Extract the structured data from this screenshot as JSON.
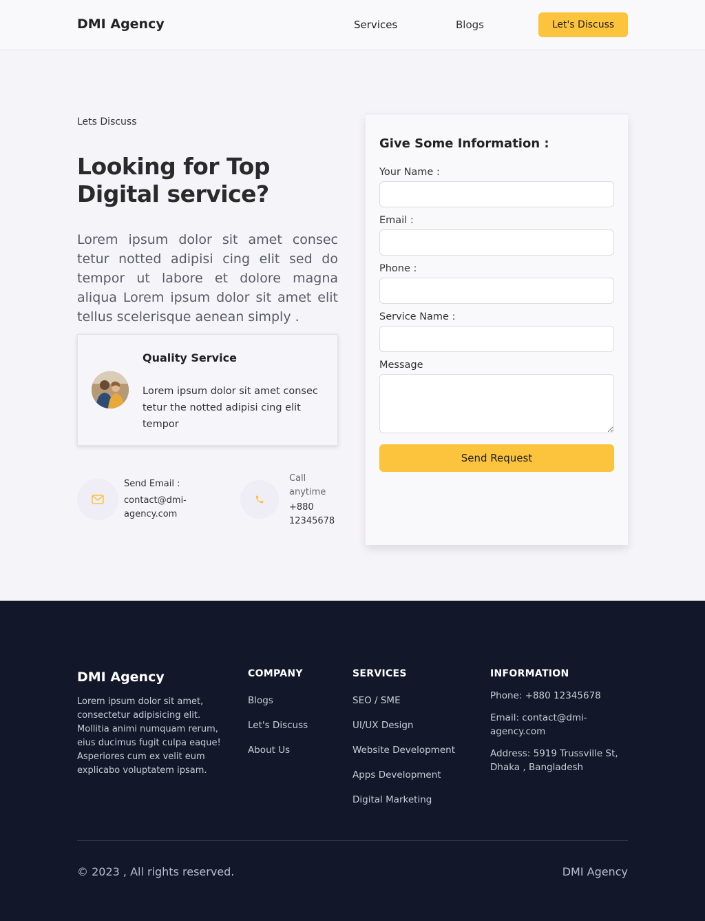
{
  "header": {
    "brand": "DMI Agency",
    "nav": {
      "services": "Services",
      "blogs": "Blogs"
    },
    "cta": "Let's Discuss"
  },
  "hero": {
    "eyebrow": "Lets Discuss",
    "headline": "Looking for Top Digital service?",
    "intro": "Lorem ipsum dolor sit amet consec tetur notted adipisi cing elit sed do tempor ut labore et dolore magna aliqua Lorem ipsum dolor sit amet elit tellus scelerisque aenean simply ."
  },
  "quality": {
    "title": "Quality Service",
    "text": "Lorem ipsum dolor sit amet consec tetur the notted adipisi cing elit tempor"
  },
  "contact": {
    "email_label": "Send Email :",
    "email_value": "contact@dmi-agency.com",
    "call_label": "Call anytime",
    "call_value": "+880 12345678",
    "icons": {
      "email": "mail-icon",
      "call": "phone-icon"
    }
  },
  "form": {
    "title": "Give Some Information :",
    "name_label": "Your Name :",
    "name_value": "",
    "email_label": "Email :",
    "email_value": "",
    "phone_label": "Phone :",
    "phone_value": "",
    "service_label": "Service Name :",
    "service_value": "",
    "message_label": "Message",
    "message_value": "",
    "submit": "Send Request"
  },
  "footer": {
    "brand": "DMI Agency",
    "about": "Lorem ipsum dolor sit amet, consectetur adipisicing elit. Mollitia animi numquam rerum, eius ducimus fugit culpa eaque! Asperiores cum ex velit eum explicabo voluptatem ipsam.",
    "company": {
      "heading": "COMPANY",
      "links": [
        "Blogs",
        "Let's Discuss",
        "About Us"
      ]
    },
    "services": {
      "heading": "SERVICES",
      "links": [
        "SEO / SME",
        "UI/UX Design",
        "Website Development",
        "Apps Development",
        "Digital Marketing"
      ]
    },
    "information": {
      "heading": "INFORMATION",
      "phone": "Phone: +880 12345678",
      "email": "Email: contact@dmi-agency.com",
      "address": "Address: 5919 Trussville St, Dhaka , Bangladesh"
    },
    "copyright": "© 2023 , All rights reserved.",
    "right_brand": "DMI Agency"
  },
  "colors": {
    "accent": "#fcc33c",
    "footer_bg": "#121829",
    "page_bg": "#f5f4f8"
  }
}
